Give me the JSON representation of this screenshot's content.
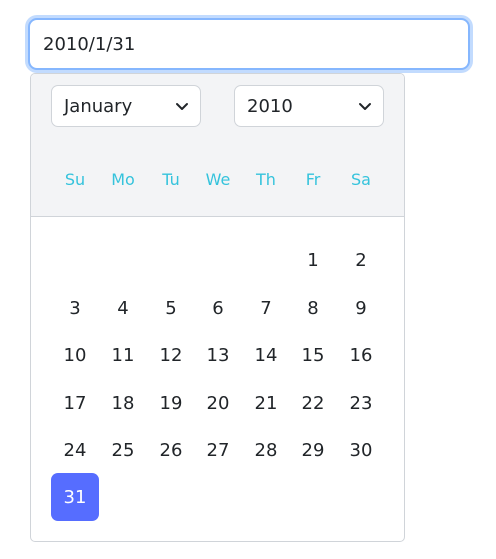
{
  "date_input": {
    "value": "2010/1/31"
  },
  "picker": {
    "month_select": {
      "value": "January"
    },
    "year_select": {
      "value": "2010"
    },
    "weekdays": [
      "Su",
      "Mo",
      "Tu",
      "We",
      "Th",
      "Fr",
      "Sa"
    ],
    "days": [
      "1",
      "2",
      "3",
      "4",
      "5",
      "6",
      "7",
      "8",
      "9",
      "10",
      "11",
      "12",
      "13",
      "14",
      "15",
      "16",
      "17",
      "18",
      "19",
      "20",
      "21",
      "22",
      "23",
      "24",
      "25",
      "26",
      "27",
      "28",
      "29",
      "30",
      "31"
    ],
    "selected_day": "31",
    "colors": {
      "accent": "#566dff",
      "weekday": "#35c3dc",
      "focus_border": "#86b7fe"
    }
  }
}
